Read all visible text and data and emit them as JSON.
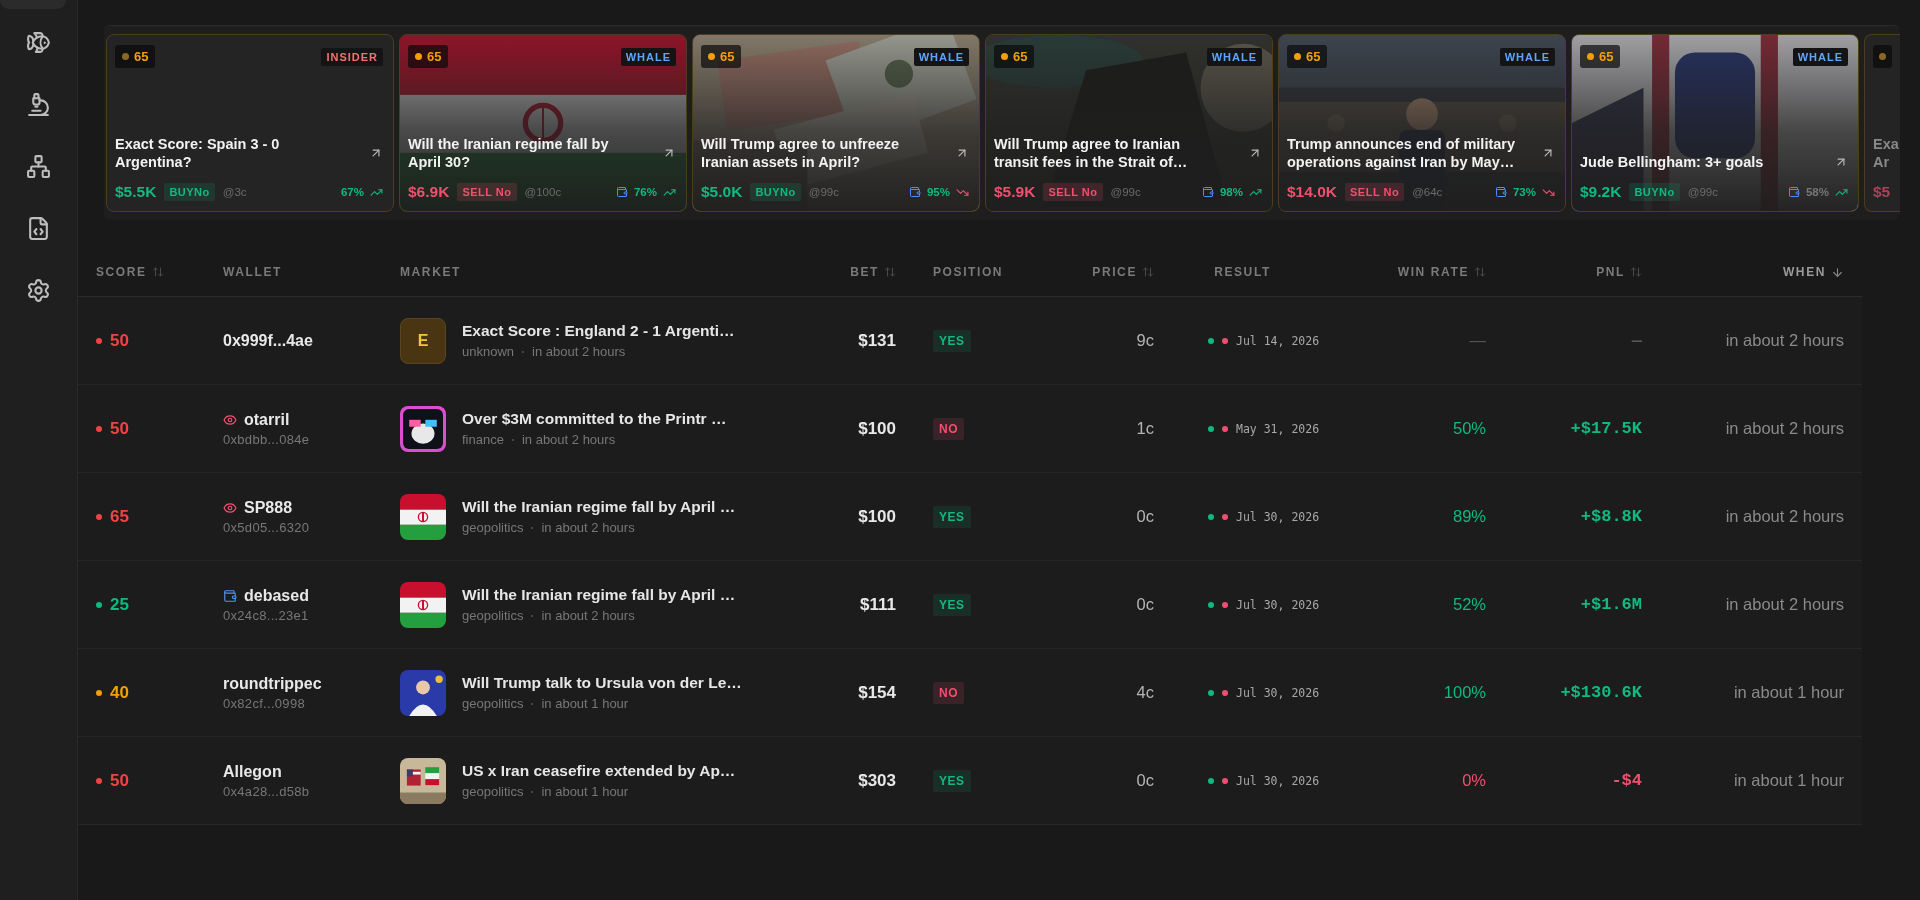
{
  "cards": [
    {
      "kind": "plain",
      "score": "65",
      "color": "#8a6a1f",
      "tag": {
        "label": "INSIDER",
        "insider": true
      },
      "title": "Exact Score: Spain 3 - 0 Argentina?",
      "amount": "$5.5K",
      "side": "BUYNo",
      "positive": true,
      "handle": "@3c",
      "wallet": false,
      "pct": "67%",
      "muted": false,
      "rising": true
    },
    {
      "kind": "picture",
      "score": "65",
      "color": "#f59e0b",
      "tag": {
        "label": "WHALE",
        "insider": false
      },
      "title": "Will the Iranian regime fall by April 30?",
      "amount": "$6.9K",
      "side": "SELL No",
      "positive": false,
      "handle": "@100c",
      "wallet": true,
      "pct": "76%",
      "muted": false,
      "rising": true
    },
    {
      "kind": "picture",
      "score": "65",
      "color": "#f59e0b",
      "tag": {
        "label": "WHALE",
        "insider": false
      },
      "title": "Will Trump agree to unfreeze Iranian assets in April?",
      "amount": "$5.0K",
      "side": "BUYNo",
      "positive": true,
      "handle": "@99c",
      "wallet": true,
      "pct": "95%",
      "muted": false,
      "rising": false
    },
    {
      "kind": "picture",
      "score": "65",
      "color": "#f59e0b",
      "tag": {
        "label": "WHALE",
        "insider": false
      },
      "title": "Will Trump agree to Iranian transit fees in the Strait of…",
      "amount": "$5.9K",
      "side": "SELL No",
      "positive": false,
      "handle": "@99c",
      "wallet": true,
      "pct": "98%",
      "muted": false,
      "rising": true
    },
    {
      "kind": "picture",
      "score": "65",
      "color": "#f59e0b",
      "tag": {
        "label": "WHALE",
        "insider": false
      },
      "title": "Trump announces end of military operations against Iran by May…",
      "amount": "$14.0K",
      "side": "SELL No",
      "positive": false,
      "handle": "@64c",
      "wallet": true,
      "pct": "73%",
      "muted": false,
      "rising": false
    },
    {
      "kind": "picture",
      "score": "65",
      "color": "#f59e0b",
      "tag": {
        "label": "WHALE",
        "insider": false
      },
      "title": "Jude Bellingham: 3+ goals",
      "amount": "$9.2K",
      "side": "BUYNo",
      "positive": true,
      "handle": "@99c",
      "wallet": true,
      "pct": "58%",
      "muted": true,
      "rising": true
    },
    {
      "kind": "peek",
      "color": "#8a6a1f",
      "title_lines": [
        "Exa",
        "Ar"
      ],
      "amount": "$5",
      "positive": false
    }
  ],
  "table": {
    "columns": [
      {
        "label": "SCORE",
        "sortable": true,
        "sorted": false
      },
      {
        "label": "WALLET",
        "sortable": false,
        "sorted": false
      },
      {
        "label": "MARKET",
        "sortable": false,
        "sorted": false
      },
      {
        "label": "BET",
        "sortable": true,
        "sorted": false
      },
      {
        "label": "POSITION",
        "sortable": false,
        "sorted": false
      },
      {
        "label": "PRICE",
        "sortable": true,
        "sorted": false
      },
      {
        "label": "RESULT",
        "sortable": false,
        "sorted": false
      },
      {
        "label": "WIN RATE",
        "sortable": true,
        "sorted": false
      },
      {
        "label": "PNL",
        "sortable": true,
        "sorted": false
      },
      {
        "label": "WHEN",
        "sortable": true,
        "sorted": true
      }
    ],
    "rows": [
      {
        "score": "50",
        "color": "#ef4444",
        "wallet": "0x999f...4ae",
        "watched": false,
        "tracked": false,
        "letter": "E",
        "title": "Exact Score : England 2 - 1 Argenti…",
        "category": "unknown",
        "time": "in about 2 hours",
        "bet": "$131",
        "position": "YES",
        "yes": true,
        "price": "9c",
        "result_date": "Jul 14, 2026",
        "win_rate": "—",
        "pnl": "—",
        "has_history": false,
        "win_positive": true,
        "pnl_positive": true,
        "when": "in about 2 hours"
      },
      {
        "score": "50",
        "color": "#ef4444",
        "wallet": "otarril",
        "watched": true,
        "tracked": false,
        "address": "0xbdbb...084e",
        "title": "Over $3M committed to the Printr …",
        "category": "finance",
        "time": "in about 2 hours",
        "bet": "$100",
        "position": "NO",
        "yes": false,
        "price": "1c",
        "result_date": "May 31, 2026",
        "win_rate": "50%",
        "pnl": "+$17.5K",
        "has_history": true,
        "win_positive": true,
        "pnl_positive": true,
        "when": "in about 2 hours"
      },
      {
        "score": "65",
        "color": "#ef4444",
        "wallet": "SP888",
        "watched": true,
        "tracked": false,
        "address": "0x5d05...6320",
        "title": "Will the Iranian regime fall by April …",
        "category": "geopolitics",
        "time": "in about 2 hours",
        "bet": "$100",
        "position": "YES",
        "yes": true,
        "price": "0c",
        "result_date": "Jul 30, 2026",
        "win_rate": "89%",
        "pnl": "+$8.8K",
        "has_history": true,
        "win_positive": true,
        "pnl_positive": true,
        "when": "in about 2 hours"
      },
      {
        "score": "25",
        "color": "#10b981",
        "wallet": "debased",
        "watched": false,
        "tracked": true,
        "address": "0x24c8...23e1",
        "title": "Will the Iranian regime fall by April …",
        "category": "geopolitics",
        "time": "in about 2 hours",
        "bet": "$111",
        "position": "YES",
        "yes": true,
        "price": "0c",
        "result_date": "Jul 30, 2026",
        "win_rate": "52%",
        "pnl": "+$1.6M",
        "has_history": true,
        "win_positive": true,
        "pnl_positive": true,
        "when": "in about 2 hours"
      },
      {
        "score": "40",
        "color": "#f59e0b",
        "wallet": "roundtrippec",
        "watched": false,
        "tracked": false,
        "address": "0x82cf...0998",
        "title": "Will Trump talk to Ursula von der Le…",
        "category": "geopolitics",
        "time": "in about 1 hour",
        "bet": "$154",
        "position": "NO",
        "yes": false,
        "price": "4c",
        "result_date": "Jul 30, 2026",
        "win_rate": "100%",
        "pnl": "+$130.6K",
        "has_history": true,
        "win_positive": true,
        "pnl_positive": true,
        "when": "in about 1 hour"
      },
      {
        "score": "50",
        "color": "#ef4444",
        "wallet": "Allegon",
        "watched": false,
        "tracked": false,
        "address": "0x4a28...d58b",
        "title": "US x Iran ceasefire extended by Ap…",
        "category": "geopolitics",
        "time": "in about 1 hour",
        "bet": "$303",
        "position": "YES",
        "yes": true,
        "price": "0c",
        "result_date": "Jul 30, 2026",
        "win_rate": "0%",
        "pnl": "-$4",
        "has_history": true,
        "win_positive": false,
        "pnl_positive": false,
        "when": "in about 1 hour"
      }
    ]
  }
}
